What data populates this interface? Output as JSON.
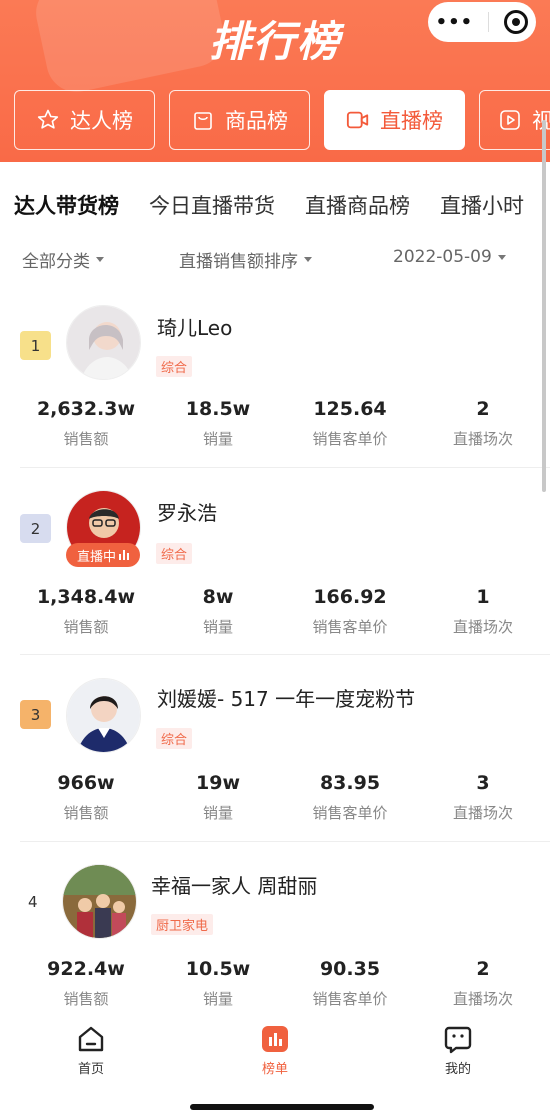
{
  "header": {
    "title": "排行榜",
    "tabs": [
      {
        "label": "达人榜",
        "icon": "star-icon"
      },
      {
        "label": "商品榜",
        "icon": "bag-icon"
      },
      {
        "label": "直播榜",
        "icon": "video-camera-icon"
      },
      {
        "label": "视",
        "icon": "play-icon"
      }
    ]
  },
  "subtabs": [
    "达人带货榜",
    "今日直播带货",
    "直播商品榜",
    "直播小时"
  ],
  "filters": {
    "category": "全部分类",
    "sort": "直播销售额排序",
    "date": "2022-05-09"
  },
  "stat_labels": {
    "sales": "销售额",
    "volume": "销量",
    "avg_price": "销售客单价",
    "sessions": "直播场次"
  },
  "live_label": "直播中",
  "items": [
    {
      "rank": "1",
      "name": "琦儿Leo",
      "tag": "综合",
      "sales": "2,632.3w",
      "volume": "18.5w",
      "avg_price": "125.64",
      "sessions": "2",
      "badge_color": "#f7e08a"
    },
    {
      "rank": "2",
      "name": "罗永浩",
      "tag": "综合",
      "sales": "1,348.4w",
      "volume": "8w",
      "avg_price": "166.92",
      "sessions": "1",
      "badge_color": "#d7dcef"
    },
    {
      "rank": "3",
      "name": "刘媛媛- 517 一年一度宠粉节",
      "tag": "综合",
      "sales": "966w",
      "volume": "19w",
      "avg_price": "83.95",
      "sessions": "3",
      "badge_color": "#f5b36a"
    },
    {
      "rank": "4",
      "name": "幸福一家人 周甜丽",
      "tag": "厨卫家电",
      "sales": "922.4w",
      "volume": "10.5w",
      "avg_price": "90.35",
      "sessions": "2",
      "badge_color": ""
    }
  ],
  "bottom_nav": [
    {
      "label": "首页",
      "icon": "home-icon"
    },
    {
      "label": "榜单",
      "icon": "chart-icon"
    },
    {
      "label": "我的",
      "icon": "profile-icon"
    }
  ],
  "colors": {
    "accent": "#f0613f",
    "header": "#fb7a55"
  }
}
